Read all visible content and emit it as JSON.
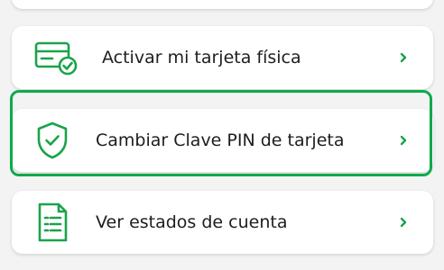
{
  "accent_color": "#1aa34a",
  "menu": {
    "items": [
      {
        "label": "Activar mi tarjeta física",
        "icon": "card-check-icon"
      },
      {
        "label": "Cambiar Clave PIN de tarjeta",
        "icon": "shield-check-icon",
        "selected": true
      },
      {
        "label": "Ver estados de cuenta",
        "icon": "document-list-icon"
      }
    ]
  }
}
